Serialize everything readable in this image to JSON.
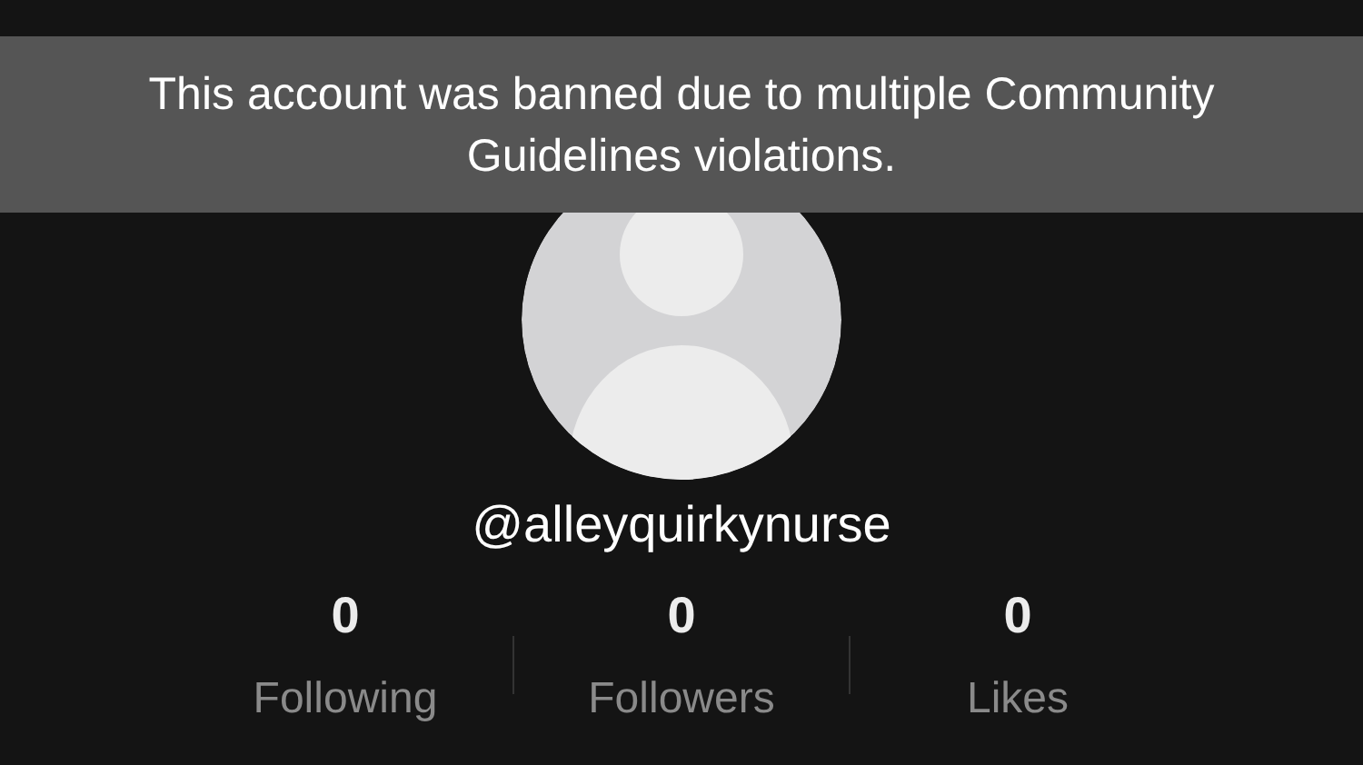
{
  "banner": {
    "text": "This account was banned due to multiple Community Guidelines violations."
  },
  "profile": {
    "username": "@alleyquirkynurse"
  },
  "stats": [
    {
      "value": "0",
      "label": "Following"
    },
    {
      "value": "0",
      "label": "Followers"
    },
    {
      "value": "0",
      "label": "Likes"
    }
  ]
}
